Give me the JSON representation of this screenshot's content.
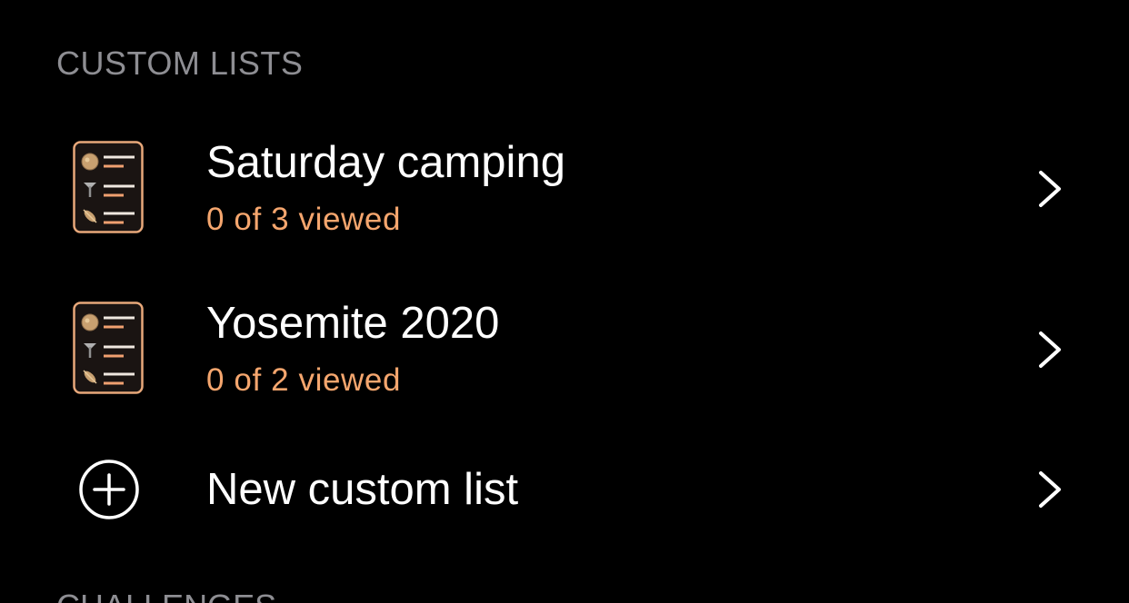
{
  "custom_lists": {
    "header": "CUSTOM LISTS",
    "items": [
      {
        "title": "Saturday camping",
        "subtitle": "0 of 3 viewed",
        "icon": "checklist-icon"
      },
      {
        "title": "Yosemite 2020",
        "subtitle": "0 of 2 viewed",
        "icon": "checklist-icon"
      }
    ],
    "new_item": {
      "title": "New custom list",
      "icon": "plus-circle-icon"
    }
  },
  "next_section": {
    "header": "CHALLENGES"
  },
  "colors": {
    "background": "#000000",
    "accent": "#f5a66e",
    "header_text": "#8e8e93",
    "icon_border": "#e8a87a"
  }
}
